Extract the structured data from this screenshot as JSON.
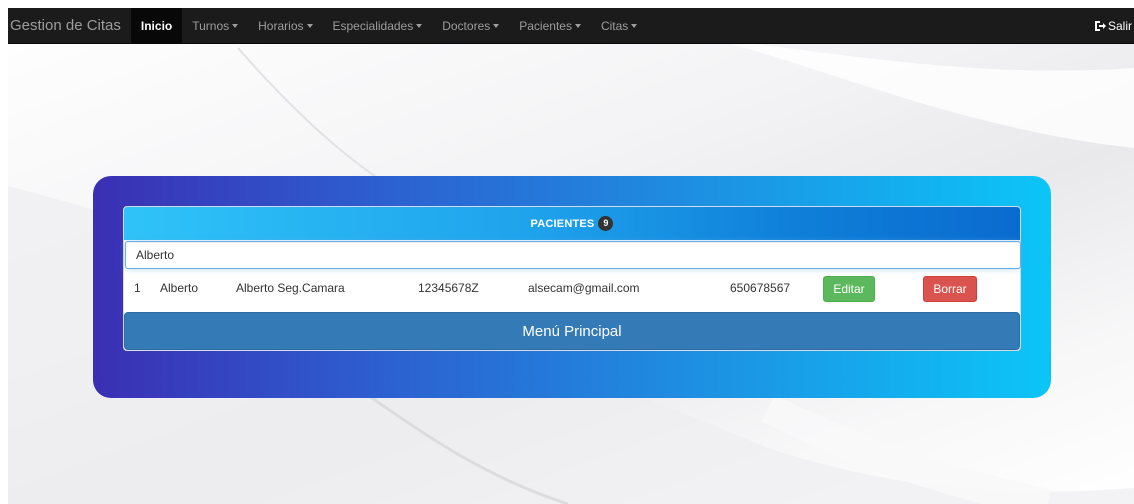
{
  "navbar": {
    "brand": "Gestion de Citas",
    "items": [
      {
        "label": "Inicio",
        "active": true,
        "dropdown": false
      },
      {
        "label": "Turnos",
        "active": false,
        "dropdown": true
      },
      {
        "label": "Horarios",
        "active": false,
        "dropdown": true
      },
      {
        "label": "Especialidades",
        "active": false,
        "dropdown": true
      },
      {
        "label": "Doctores",
        "active": false,
        "dropdown": true
      },
      {
        "label": "Pacientes",
        "active": false,
        "dropdown": true
      },
      {
        "label": "Citas",
        "active": false,
        "dropdown": true
      }
    ],
    "logout_label": "Salir",
    "logout_icon": "logout-icon"
  },
  "patients": {
    "title": "PACIENTES",
    "count": "9",
    "search_value": "Alberto",
    "rows": [
      {
        "id": "1",
        "name": "Alberto",
        "surname": "Alberto Seg.Camara",
        "dni": "12345678Z",
        "email": "alsecam@gmail.com",
        "phone": "650678567",
        "edit_label": "Editar",
        "delete_label": "Borrar"
      }
    ],
    "menu_label": "Menú Principal"
  },
  "colors": {
    "navbar": "#1b1b1b",
    "edit": "#5cb85c",
    "delete": "#d9534f",
    "primary": "#337ab7"
  }
}
